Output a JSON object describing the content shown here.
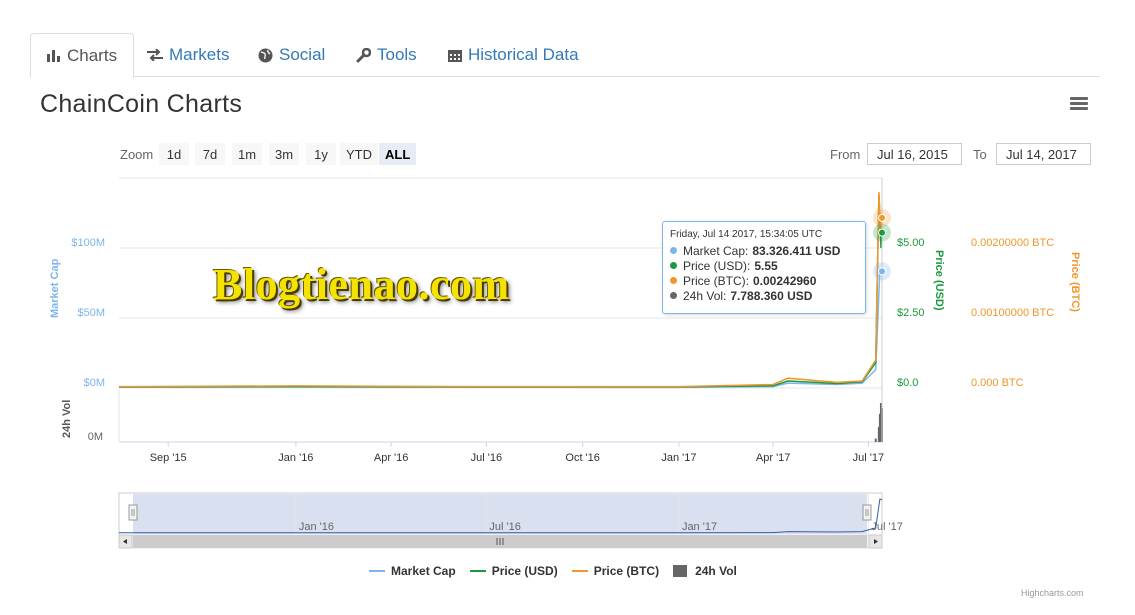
{
  "tabs": [
    {
      "label": "Charts",
      "icon": "bar-chart-icon",
      "active": true
    },
    {
      "label": "Markets",
      "icon": "exchange-icon",
      "active": false
    },
    {
      "label": "Social",
      "icon": "globe-icon",
      "active": false
    },
    {
      "label": "Tools",
      "icon": "wrench-icon",
      "active": false
    },
    {
      "label": "Historical Data",
      "icon": "calendar-icon",
      "active": false
    }
  ],
  "title": "ChainCoin Charts",
  "menu_icon": "hamburger-menu-icon",
  "zoom": {
    "label": "Zoom",
    "buttons": [
      "1d",
      "7d",
      "1m",
      "3m",
      "1y",
      "YTD",
      "ALL"
    ],
    "active": "ALL"
  },
  "range": {
    "from_label": "From",
    "from_value": "Jul 16, 2015",
    "to_label": "To",
    "to_value": "Jul 14, 2017"
  },
  "watermark": "Blogtienao.com",
  "tooltip": {
    "header": "Friday, Jul 14 2017, 15:34:05 UTC",
    "rows": [
      {
        "label": "Market Cap:",
        "value": "83.326.411 USD",
        "color": "#7cb5ec"
      },
      {
        "label": "Price (USD):",
        "value": "5.55",
        "color": "#1a9a3c"
      },
      {
        "label": "Price (BTC):",
        "value": "0.00242960",
        "color": "#f0962a"
      },
      {
        "label": "24h Vol:",
        "value": "7.788.360 USD",
        "color": "#666666"
      }
    ]
  },
  "legend": [
    {
      "label": "Market Cap",
      "color": "#7cb5ec",
      "kind": "line"
    },
    {
      "label": "Price (USD)",
      "color": "#1a9a3c",
      "kind": "line"
    },
    {
      "label": "Price (BTC)",
      "color": "#f0962a",
      "kind": "line"
    },
    {
      "label": "24h Vol",
      "color": "#666666",
      "kind": "box"
    }
  ],
  "credits": "Highcharts.com",
  "colors": {
    "market_cap": "#7cb5ec",
    "price_usd": "#1a9a3c",
    "price_btc": "#f0962a",
    "volume": "#666666"
  },
  "chart_data": {
    "type": "line",
    "x_range": [
      "2015-07-16",
      "2017-07-14"
    ],
    "x_ticks": [
      "Sep '15",
      "Jan '16",
      "Apr '16",
      "Jul '16",
      "Oct '16",
      "Jan '17",
      "Apr '17",
      "Jul '17"
    ],
    "navigator_ticks": [
      "Jan '16",
      "Jul '16",
      "Jan '17",
      "Jul '17"
    ],
    "axes": {
      "market_cap": {
        "title": "Market Cap",
        "ticks": [
          "$0M",
          "$50M",
          "$100M"
        ],
        "range": [
          0,
          100000000
        ]
      },
      "price_usd": {
        "title": "Price (USD)",
        "ticks": [
          "$0.0",
          "$2.50",
          "$5.00"
        ],
        "range": [
          0,
          5.0
        ]
      },
      "price_btc": {
        "title": "Price (BTC)",
        "ticks": [
          "0.000 BTC",
          "0.00100000 BTC",
          "0.00200000 BTC"
        ],
        "range": [
          0,
          0.002
        ]
      },
      "volume": {
        "title": "24h Vol",
        "ticks": [
          "0M"
        ]
      }
    },
    "series": [
      {
        "name": "Market Cap",
        "x": [
          "2015-07-16",
          "2016-01-01",
          "2016-07-01",
          "2017-01-01",
          "2017-04-01",
          "2017-04-15",
          "2017-06-01",
          "2017-06-25",
          "2017-07-08",
          "2017-07-12",
          "2017-07-14"
        ],
        "values": [
          600000,
          700000,
          500000,
          400000,
          1000000,
          3500000,
          2500000,
          3500000,
          13000000,
          85000000,
          83326411
        ]
      },
      {
        "name": "Price (USD)",
        "x": [
          "2015-07-16",
          "2016-01-01",
          "2016-07-01",
          "2017-01-01",
          "2017-04-01",
          "2017-04-15",
          "2017-06-01",
          "2017-06-25",
          "2017-07-08",
          "2017-07-11",
          "2017-07-13",
          "2017-07-14"
        ],
        "values": [
          0.04,
          0.05,
          0.04,
          0.04,
          0.08,
          0.25,
          0.16,
          0.22,
          0.9,
          6.9,
          5.0,
          5.55
        ]
      },
      {
        "name": "Price (BTC)",
        "x": [
          "2015-07-16",
          "2016-01-01",
          "2016-07-01",
          "2017-01-01",
          "2017-04-01",
          "2017-04-15",
          "2017-06-01",
          "2017-06-25",
          "2017-07-08",
          "2017-07-11",
          "2017-07-13",
          "2017-07-14"
        ],
        "values": [
          2e-05,
          3e-05,
          2e-05,
          2e-05,
          5e-05,
          0.00014,
          8e-05,
          0.0001,
          0.0004,
          0.0028,
          0.0022,
          0.0024296
        ]
      },
      {
        "name": "24h Vol",
        "x": [
          "2017-07-08",
          "2017-07-11",
          "2017-07-12",
          "2017-07-13",
          "2017-07-14"
        ],
        "values": [
          800000,
          3500000,
          6500000,
          9000000,
          7788360
        ]
      }
    ]
  }
}
